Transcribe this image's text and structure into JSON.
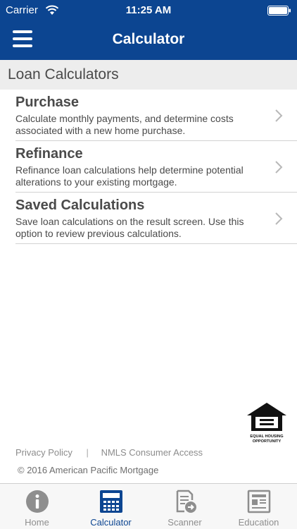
{
  "status_bar": {
    "carrier": "Carrier",
    "time": "11:25 AM",
    "wifi_icon": "wifi-icon",
    "battery_icon": "battery-icon"
  },
  "nav": {
    "title": "Calculator",
    "menu_icon": "hamburger-menu-icon"
  },
  "section": {
    "title": "Loan Calculators"
  },
  "items": [
    {
      "title": "Purchase",
      "description": "Calculate monthly payments, and determine costs associated with a new home purchase."
    },
    {
      "title": "Refinance",
      "description": "Refinance loan calculations help determine potential alterations to your existing mortgage."
    },
    {
      "title": "Saved Calculations",
      "description": "Save loan calculations on the result screen. Use this option to review previous calculations."
    }
  ],
  "logo": {
    "line1": "EQUAL HOUSING",
    "line2": "OPPORTUNITY"
  },
  "footer": {
    "privacy_policy": "Privacy Policy",
    "separator": "|",
    "nmls": "NMLS Consumer Access",
    "copyright": "© 2016 American Pacific Mortgage"
  },
  "tabs": [
    {
      "label": "Home",
      "icon": "info-icon",
      "active": false
    },
    {
      "label": "Calculator",
      "icon": "calculator-icon",
      "active": true
    },
    {
      "label": "Scanner",
      "icon": "scanner-icon",
      "active": false
    },
    {
      "label": "Education",
      "icon": "newspaper-icon",
      "active": false
    }
  ],
  "colors": {
    "primary": "#0c4591",
    "section_bg": "#ededed",
    "tab_inactive": "#8e8e8e"
  }
}
